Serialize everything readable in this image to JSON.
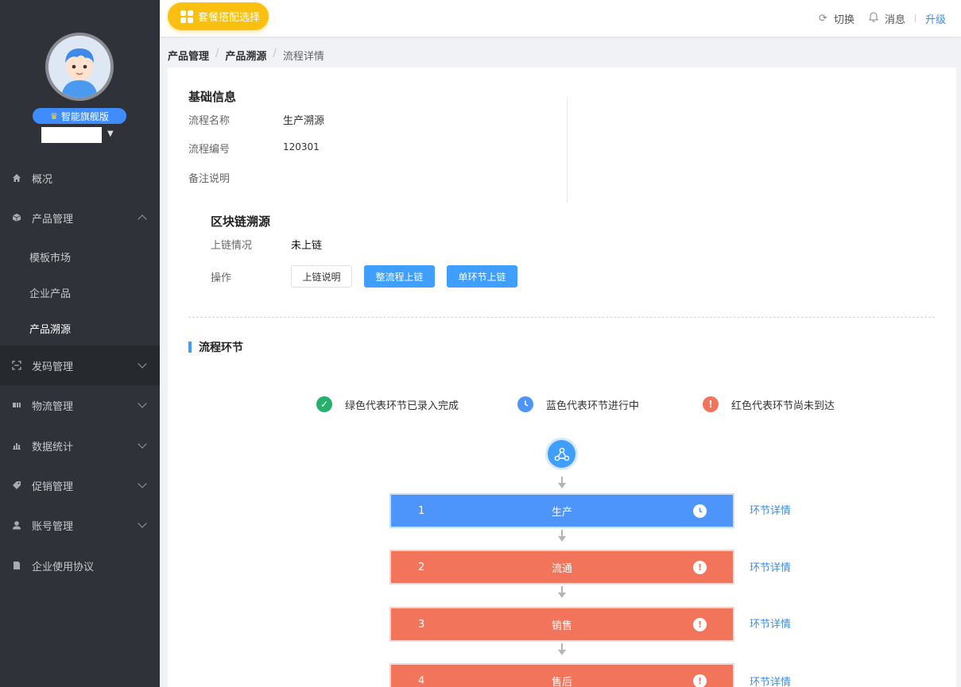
{
  "sidebar": {
    "edition": "智能旗舰版",
    "menu": [
      {
        "label": "概况",
        "icon": "home-icon"
      },
      {
        "label": "产品管理",
        "icon": "box-icon"
      },
      {
        "label": "发码管理",
        "icon": "scan-icon"
      },
      {
        "label": "物流管理",
        "icon": "truck-icon"
      },
      {
        "label": "数据统计",
        "icon": "chart-icon"
      },
      {
        "label": "促销管理",
        "icon": "tag-icon"
      },
      {
        "label": "账号管理",
        "icon": "user-icon"
      },
      {
        "label": "企业使用协议",
        "icon": "document-icon"
      }
    ],
    "submenu": [
      "模板市场",
      "企业产品",
      "产品溯源"
    ]
  },
  "topbar": {
    "package_button": "套餐搭配选择",
    "switch": "切换",
    "messages": "消息",
    "upgrade": "升级"
  },
  "breadcrumb": [
    "产品管理",
    "产品溯源",
    "流程详情"
  ],
  "basic_info": {
    "title": "基础信息",
    "name_label": "流程名称",
    "name_value": "生产溯源",
    "code_label": "流程编号",
    "code_value": "120301",
    "note_label": "备注说明",
    "note_value": ""
  },
  "blockchain": {
    "title": "区块链溯源",
    "status_label": "上链情况",
    "status_value": "未上链",
    "action_label": "操作",
    "buttons": [
      "上链说明",
      "整流程上链",
      "单环节上链"
    ]
  },
  "flow": {
    "title": "流程环节",
    "legend": [
      {
        "text": "绿色代表环节已录入完成",
        "color": "#27b06b",
        "symbol": "✓"
      },
      {
        "text": "蓝色代表环节进行中",
        "color": "#4d94fb",
        "symbol": "◔"
      },
      {
        "text": "红色代表环节尚未到达",
        "color": "#f2745b",
        "symbol": "!"
      }
    ],
    "steps": [
      {
        "num": "1",
        "name": "生产",
        "status": "blue",
        "link": "环节详情"
      },
      {
        "num": "2",
        "name": "流通",
        "status": "red",
        "link": "环节详情"
      },
      {
        "num": "3",
        "name": "销售",
        "status": "red",
        "link": "环节详情"
      },
      {
        "num": "4",
        "name": "售后",
        "status": "red",
        "link": "环节详情"
      }
    ]
  },
  "colors": {
    "primary": "#409eff",
    "in_progress": "#4d94fb",
    "not_reached": "#f2745b",
    "done": "#27b06b",
    "badge": "#fbbf0f"
  }
}
